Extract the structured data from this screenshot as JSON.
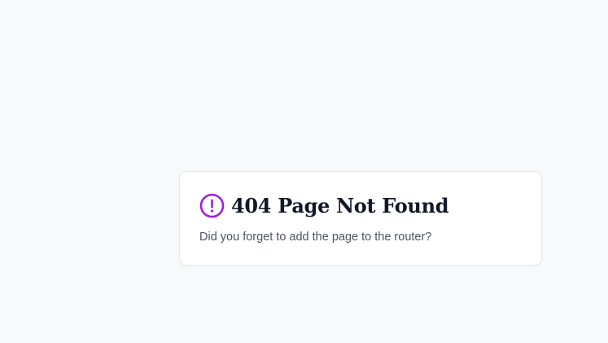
{
  "colors": {
    "background": "#f8f9fb",
    "card": "#ffffff",
    "accent": "#a020d6",
    "title": "#111827",
    "message": "#4b5563"
  },
  "error": {
    "icon": "alert-circle-icon",
    "title": "404 Page Not Found",
    "message": "Did you forget to add the page to the router?"
  }
}
